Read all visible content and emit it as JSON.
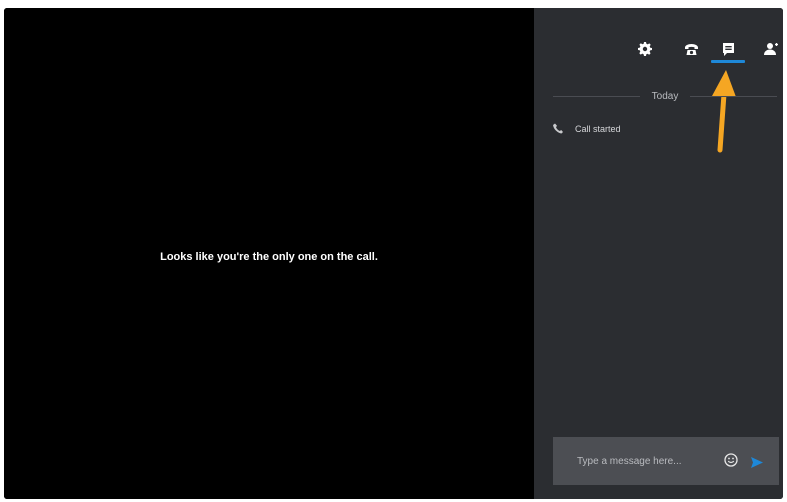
{
  "window": {
    "controls": [
      {
        "name": "close",
        "color": "#fc5b57"
      },
      {
        "name": "minimize",
        "color": "#fdbb2f"
      },
      {
        "name": "maximize",
        "color": "#28c840"
      }
    ]
  },
  "call": {
    "message": "Looks like you're the only one on the call."
  },
  "toolbar": {
    "icons": [
      "gear-icon",
      "phone-icon",
      "chat-icon",
      "add-person-icon"
    ],
    "active": "chat-icon",
    "accent_color": "#1e88d8",
    "annotation_color": "#f5a623"
  },
  "chat": {
    "date_label": "Today",
    "events": [
      {
        "icon": "phone-icon",
        "text": "Call started"
      }
    ]
  },
  "composer": {
    "placeholder": "Type a message here...",
    "value": ""
  }
}
